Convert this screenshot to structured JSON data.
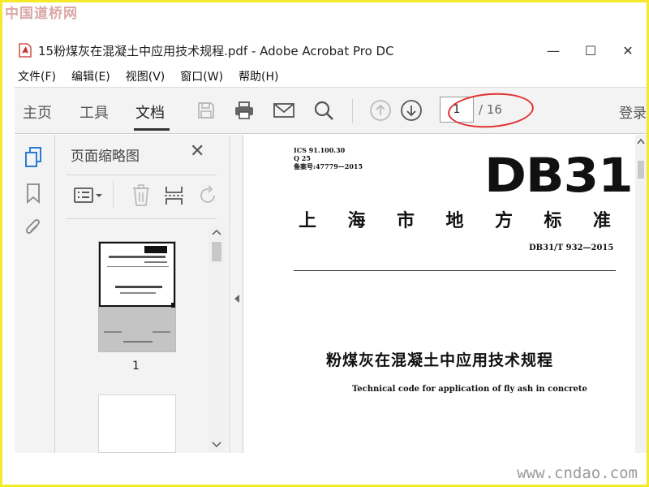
{
  "watermark": {
    "top": "中国道桥网",
    "bottom": "www.cndao.com"
  },
  "window": {
    "title": "15粉煤灰在混凝土中应用技术规程.pdf - Adobe Acrobat Pro DC",
    "minimize": "—",
    "maximize": "☐",
    "close": "✕"
  },
  "menubar": {
    "items": [
      "文件(F)",
      "编辑(E)",
      "视图(V)",
      "窗口(W)",
      "帮助(H)"
    ]
  },
  "toolbar": {
    "tabs": [
      "主页",
      "工具",
      "文档"
    ],
    "active_tab": "文档",
    "icons": [
      "save-icon",
      "print-icon",
      "mail-icon",
      "search-icon",
      "page-up-icon",
      "page-down-icon"
    ],
    "page_current": "1",
    "page_total": "/ 16",
    "login": "登录"
  },
  "left_rail": {
    "icons": [
      "page-thumbnails-icon",
      "bookmark-icon",
      "attachment-icon"
    ]
  },
  "thumbnail_panel": {
    "title": "页面缩略图",
    "close": "✕",
    "tools": [
      "page-options-icon",
      "delete-icon",
      "extract-icon",
      "rotate-icon"
    ],
    "pages": [
      {
        "label": "1"
      }
    ]
  },
  "document": {
    "meta_line1": "ICS  91.100.30",
    "meta_line2": "Q  25",
    "meta_line3": "备案号:47779—2015",
    "logo": "DB31",
    "org_chars": [
      "上",
      "海",
      "市",
      "地",
      "方",
      "标",
      "准"
    ],
    "standard_no": "DB31/T 932—2015",
    "title_cn": "粉煤灰在混凝土中应用技术规程",
    "title_en": "Technical code for application of fly ash in concrete"
  },
  "colors": {
    "annotation_oval": "#e23232",
    "frame": "#f2ea2a",
    "toolbar_bg": "#f3f3f3",
    "accent": "#2a7bd4"
  }
}
